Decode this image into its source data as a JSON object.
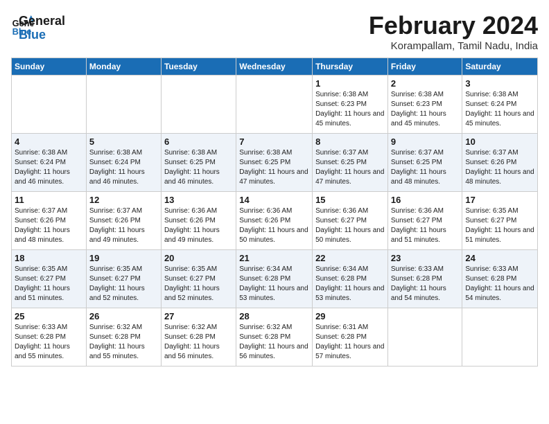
{
  "logo": {
    "line1": "General",
    "line2": "Blue"
  },
  "title": "February 2024",
  "location": "Korampallam, Tamil Nadu, India",
  "weekdays": [
    "Sunday",
    "Monday",
    "Tuesday",
    "Wednesday",
    "Thursday",
    "Friday",
    "Saturday"
  ],
  "weeks": [
    [
      {
        "day": "",
        "sunrise": "",
        "sunset": "",
        "daylight": ""
      },
      {
        "day": "",
        "sunrise": "",
        "sunset": "",
        "daylight": ""
      },
      {
        "day": "",
        "sunrise": "",
        "sunset": "",
        "daylight": ""
      },
      {
        "day": "",
        "sunrise": "",
        "sunset": "",
        "daylight": ""
      },
      {
        "day": "1",
        "sunrise": "Sunrise: 6:38 AM",
        "sunset": "Sunset: 6:23 PM",
        "daylight": "Daylight: 11 hours and 45 minutes."
      },
      {
        "day": "2",
        "sunrise": "Sunrise: 6:38 AM",
        "sunset": "Sunset: 6:23 PM",
        "daylight": "Daylight: 11 hours and 45 minutes."
      },
      {
        "day": "3",
        "sunrise": "Sunrise: 6:38 AM",
        "sunset": "Sunset: 6:24 PM",
        "daylight": "Daylight: 11 hours and 45 minutes."
      }
    ],
    [
      {
        "day": "4",
        "sunrise": "Sunrise: 6:38 AM",
        "sunset": "Sunset: 6:24 PM",
        "daylight": "Daylight: 11 hours and 46 minutes."
      },
      {
        "day": "5",
        "sunrise": "Sunrise: 6:38 AM",
        "sunset": "Sunset: 6:24 PM",
        "daylight": "Daylight: 11 hours and 46 minutes."
      },
      {
        "day": "6",
        "sunrise": "Sunrise: 6:38 AM",
        "sunset": "Sunset: 6:25 PM",
        "daylight": "Daylight: 11 hours and 46 minutes."
      },
      {
        "day": "7",
        "sunrise": "Sunrise: 6:38 AM",
        "sunset": "Sunset: 6:25 PM",
        "daylight": "Daylight: 11 hours and 47 minutes."
      },
      {
        "day": "8",
        "sunrise": "Sunrise: 6:37 AM",
        "sunset": "Sunset: 6:25 PM",
        "daylight": "Daylight: 11 hours and 47 minutes."
      },
      {
        "day": "9",
        "sunrise": "Sunrise: 6:37 AM",
        "sunset": "Sunset: 6:25 PM",
        "daylight": "Daylight: 11 hours and 48 minutes."
      },
      {
        "day": "10",
        "sunrise": "Sunrise: 6:37 AM",
        "sunset": "Sunset: 6:26 PM",
        "daylight": "Daylight: 11 hours and 48 minutes."
      }
    ],
    [
      {
        "day": "11",
        "sunrise": "Sunrise: 6:37 AM",
        "sunset": "Sunset: 6:26 PM",
        "daylight": "Daylight: 11 hours and 48 minutes."
      },
      {
        "day": "12",
        "sunrise": "Sunrise: 6:37 AM",
        "sunset": "Sunset: 6:26 PM",
        "daylight": "Daylight: 11 hours and 49 minutes."
      },
      {
        "day": "13",
        "sunrise": "Sunrise: 6:36 AM",
        "sunset": "Sunset: 6:26 PM",
        "daylight": "Daylight: 11 hours and 49 minutes."
      },
      {
        "day": "14",
        "sunrise": "Sunrise: 6:36 AM",
        "sunset": "Sunset: 6:26 PM",
        "daylight": "Daylight: 11 hours and 50 minutes."
      },
      {
        "day": "15",
        "sunrise": "Sunrise: 6:36 AM",
        "sunset": "Sunset: 6:27 PM",
        "daylight": "Daylight: 11 hours and 50 minutes."
      },
      {
        "day": "16",
        "sunrise": "Sunrise: 6:36 AM",
        "sunset": "Sunset: 6:27 PM",
        "daylight": "Daylight: 11 hours and 51 minutes."
      },
      {
        "day": "17",
        "sunrise": "Sunrise: 6:35 AM",
        "sunset": "Sunset: 6:27 PM",
        "daylight": "Daylight: 11 hours and 51 minutes."
      }
    ],
    [
      {
        "day": "18",
        "sunrise": "Sunrise: 6:35 AM",
        "sunset": "Sunset: 6:27 PM",
        "daylight": "Daylight: 11 hours and 51 minutes."
      },
      {
        "day": "19",
        "sunrise": "Sunrise: 6:35 AM",
        "sunset": "Sunset: 6:27 PM",
        "daylight": "Daylight: 11 hours and 52 minutes."
      },
      {
        "day": "20",
        "sunrise": "Sunrise: 6:35 AM",
        "sunset": "Sunset: 6:27 PM",
        "daylight": "Daylight: 11 hours and 52 minutes."
      },
      {
        "day": "21",
        "sunrise": "Sunrise: 6:34 AM",
        "sunset": "Sunset: 6:28 PM",
        "daylight": "Daylight: 11 hours and 53 minutes."
      },
      {
        "day": "22",
        "sunrise": "Sunrise: 6:34 AM",
        "sunset": "Sunset: 6:28 PM",
        "daylight": "Daylight: 11 hours and 53 minutes."
      },
      {
        "day": "23",
        "sunrise": "Sunrise: 6:33 AM",
        "sunset": "Sunset: 6:28 PM",
        "daylight": "Daylight: 11 hours and 54 minutes."
      },
      {
        "day": "24",
        "sunrise": "Sunrise: 6:33 AM",
        "sunset": "Sunset: 6:28 PM",
        "daylight": "Daylight: 11 hours and 54 minutes."
      }
    ],
    [
      {
        "day": "25",
        "sunrise": "Sunrise: 6:33 AM",
        "sunset": "Sunset: 6:28 PM",
        "daylight": "Daylight: 11 hours and 55 minutes."
      },
      {
        "day": "26",
        "sunrise": "Sunrise: 6:32 AM",
        "sunset": "Sunset: 6:28 PM",
        "daylight": "Daylight: 11 hours and 55 minutes."
      },
      {
        "day": "27",
        "sunrise": "Sunrise: 6:32 AM",
        "sunset": "Sunset: 6:28 PM",
        "daylight": "Daylight: 11 hours and 56 minutes."
      },
      {
        "day": "28",
        "sunrise": "Sunrise: 6:32 AM",
        "sunset": "Sunset: 6:28 PM",
        "daylight": "Daylight: 11 hours and 56 minutes."
      },
      {
        "day": "29",
        "sunrise": "Sunrise: 6:31 AM",
        "sunset": "Sunset: 6:28 PM",
        "daylight": "Daylight: 11 hours and 57 minutes."
      },
      {
        "day": "",
        "sunrise": "",
        "sunset": "",
        "daylight": ""
      },
      {
        "day": "",
        "sunrise": "",
        "sunset": "",
        "daylight": ""
      }
    ]
  ]
}
